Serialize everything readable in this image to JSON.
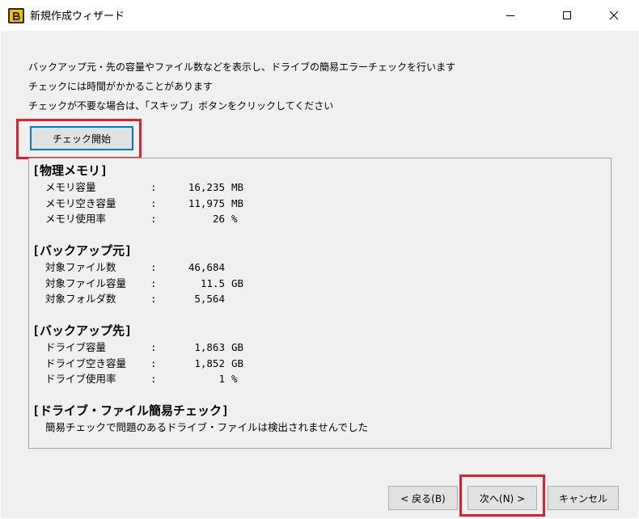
{
  "window": {
    "title": "新規作成ウィザード"
  },
  "description": [
    "バックアップ元・先の容量やファイル数などを表示し、ドライブの簡易エラーチェックを行います",
    "チェックには時間がかかることがあります",
    "チェックが不要な場合は、「スキップ」ボタンをクリックしてください"
  ],
  "check_button": {
    "label": "チェック開始"
  },
  "memory": {
    "title": "[物理メモリ]",
    "rows": [
      {
        "label": "メモリ容量",
        "colon": ":",
        "value": "16,235",
        "unit": "MB"
      },
      {
        "label": "メモリ空き容量",
        "colon": ":",
        "value": "11,975",
        "unit": "MB"
      },
      {
        "label": "メモリ使用率",
        "colon": ":",
        "value": "26",
        "unit": "%"
      }
    ]
  },
  "source": {
    "title": "[バックアップ元]",
    "rows": [
      {
        "label": "対象ファイル数",
        "colon": ":",
        "value": "46,684",
        "unit": ""
      },
      {
        "label": "対象ファイル容量",
        "colon": ":",
        "value": "11.5",
        "unit": "GB"
      },
      {
        "label": "対象フォルダ数",
        "colon": ":",
        "value": "5,564",
        "unit": ""
      }
    ]
  },
  "destination": {
    "title": "[バックアップ先]",
    "rows": [
      {
        "label": "ドライブ容量",
        "colon": ":",
        "value": "1,863",
        "unit": "GB"
      },
      {
        "label": "ドライブ空き容量",
        "colon": ":",
        "value": "1,852",
        "unit": "GB"
      },
      {
        "label": "ドライブ使用率",
        "colon": ":",
        "value": "1",
        "unit": "%"
      }
    ]
  },
  "check_result": {
    "title": "[ドライブ・ファイル簡易チェック]",
    "message": "簡易チェックで問題のあるドライブ・ファイルは検出されませんでした"
  },
  "buttons": {
    "back": "< 戻る(B)",
    "next": "次へ(N) >",
    "cancel": "キャンセル"
  },
  "colors": {
    "highlight": "#e0202a",
    "button_face": "#e1e1e1",
    "focus": "#0078d7",
    "dialog_bg": "#f0f0f0"
  },
  "icons": {
    "app": "app-icon",
    "minimize": "minimize-icon",
    "maximize": "maximize-icon",
    "close": "close-icon"
  }
}
